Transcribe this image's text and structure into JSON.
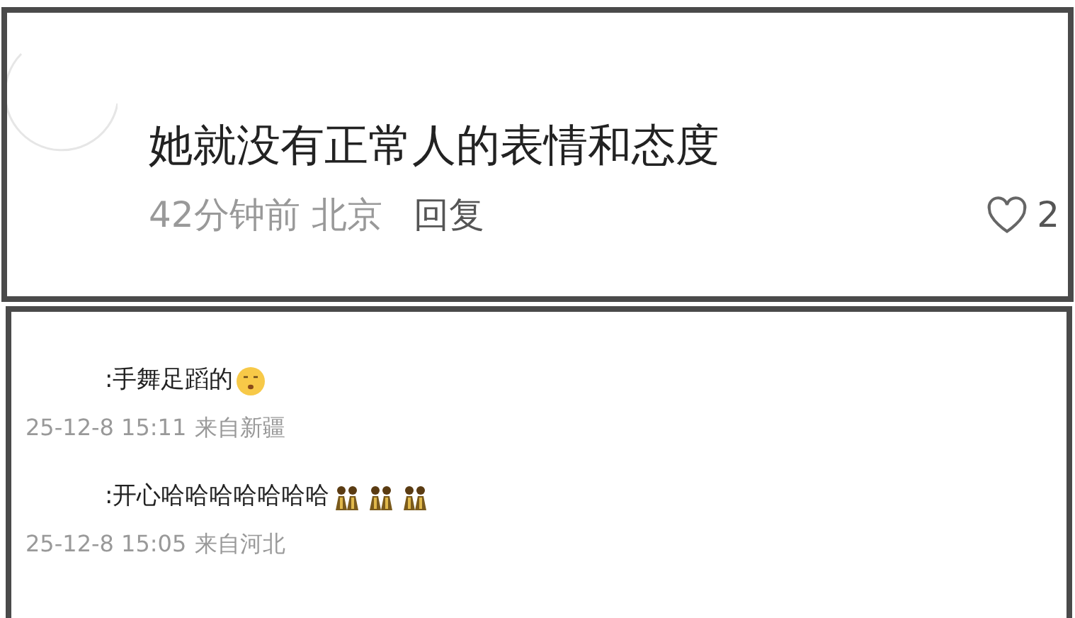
{
  "comment": {
    "text": "她就没有正常人的表情和态度",
    "time": "42分钟前",
    "location": "北京",
    "reply": "回复",
    "likes": "2"
  },
  "replies": [
    {
      "text": ":手舞足蹈的",
      "kind": "face",
      "time": "25-12-8 15:11",
      "location": "来自新疆"
    },
    {
      "text": ":开心哈哈哈哈哈哈哈",
      "kind": "figures",
      "time": "25-12-8 15:05",
      "location": "来自河北"
    }
  ]
}
